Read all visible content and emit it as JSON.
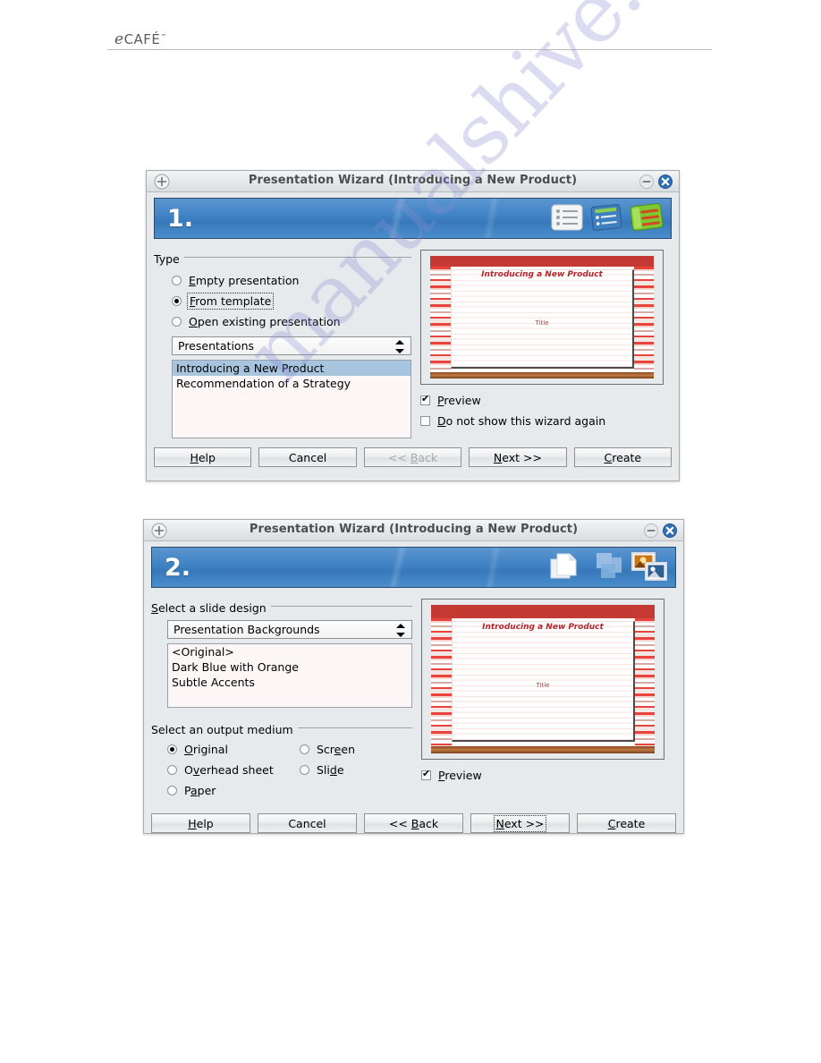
{
  "page": {
    "brand": "eCAFÉ",
    "brand_tm": "™",
    "watermark": "manualshive.com"
  },
  "dialog1": {
    "title": "Presentation Wizard (Introducing a New Product)",
    "step_number": "1.",
    "titlebar_icons": [
      "add-circle-icon",
      "minimize-icon",
      "close-icon"
    ],
    "banner_icons": [
      "outline-list-icon",
      "blue-list-icon",
      "green-list-icon"
    ],
    "type_group": {
      "label": "Type",
      "options": [
        {
          "label": "Empty presentation",
          "accel": "E",
          "selected": false
        },
        {
          "label": "From template",
          "accel": "F",
          "selected": true,
          "focused": true
        },
        {
          "label": "Open existing presentation",
          "accel": "O",
          "selected": false
        }
      ]
    },
    "combo": {
      "value": "Presentations"
    },
    "list": {
      "items": [
        {
          "label": "Introducing a New Product",
          "selected": true
        },
        {
          "label": "Recommendation of a Strategy",
          "selected": false
        }
      ]
    },
    "preview": {
      "slide_title": "Introducing a New Product",
      "slide_subtitle": "Title"
    },
    "checkboxes": [
      {
        "label": "Preview",
        "accel": "P",
        "checked": true
      },
      {
        "label": "Do not show this wizard again",
        "accel": "D",
        "checked": false
      }
    ],
    "buttons": [
      {
        "label": "Help",
        "accel": "H",
        "disabled": false,
        "focused": false
      },
      {
        "label": "Cancel",
        "accel": "",
        "disabled": false,
        "focused": false
      },
      {
        "label": "<< Back",
        "accel": "B",
        "disabled": true,
        "focused": false
      },
      {
        "label": "Next >>",
        "accel": "N",
        "disabled": false,
        "focused": false
      },
      {
        "label": "Create",
        "accel": "C",
        "disabled": false,
        "focused": false
      }
    ]
  },
  "dialog2": {
    "title": "Presentation Wizard (Introducing a New Product)",
    "step_number": "2.",
    "titlebar_icons": [
      "add-circle-icon",
      "minimize-icon",
      "close-icon"
    ],
    "banner_icons": [
      "copy-pages-icon",
      "overlap-pages-icon",
      "photos-icon"
    ],
    "design_group": {
      "label": "Select a slide design",
      "accel": "S"
    },
    "combo": {
      "value": "Presentation Backgrounds"
    },
    "list": {
      "items": [
        {
          "label": "<Original>",
          "selected": false
        },
        {
          "label": "Dark Blue with Orange",
          "selected": false
        },
        {
          "label": "Subtle Accents",
          "selected": false
        }
      ]
    },
    "medium_group": {
      "label": "Select an output medium",
      "options_left": [
        {
          "label": "Original",
          "accel": "O",
          "selected": true
        },
        {
          "label": "Overhead sheet",
          "accel": "v",
          "selected": false
        },
        {
          "label": "Paper",
          "accel": "a",
          "selected": false
        }
      ],
      "options_right": [
        {
          "label": "Screen",
          "accel": "e",
          "selected": false
        },
        {
          "label": "Slide",
          "accel": "d",
          "selected": false
        }
      ]
    },
    "preview": {
      "slide_title": "Introducing a New Product",
      "slide_subtitle": "Title"
    },
    "checkboxes": [
      {
        "label": "Preview",
        "accel": "P",
        "checked": true
      }
    ],
    "buttons": [
      {
        "label": "Help",
        "accel": "H",
        "disabled": false,
        "focused": false
      },
      {
        "label": "Cancel",
        "accel": "",
        "disabled": false,
        "focused": false
      },
      {
        "label": "<< Back",
        "accel": "B",
        "disabled": false,
        "focused": false
      },
      {
        "label": "Next >>",
        "accel": "N",
        "disabled": false,
        "focused": true
      },
      {
        "label": "Create",
        "accel": "C",
        "disabled": false,
        "focused": false
      }
    ]
  },
  "colors": {
    "banner_blue": "#3f82c4",
    "selection_blue": "#a8c5e0",
    "slide_red": "#c43a33",
    "dialog_bg": "#e7eaec"
  }
}
